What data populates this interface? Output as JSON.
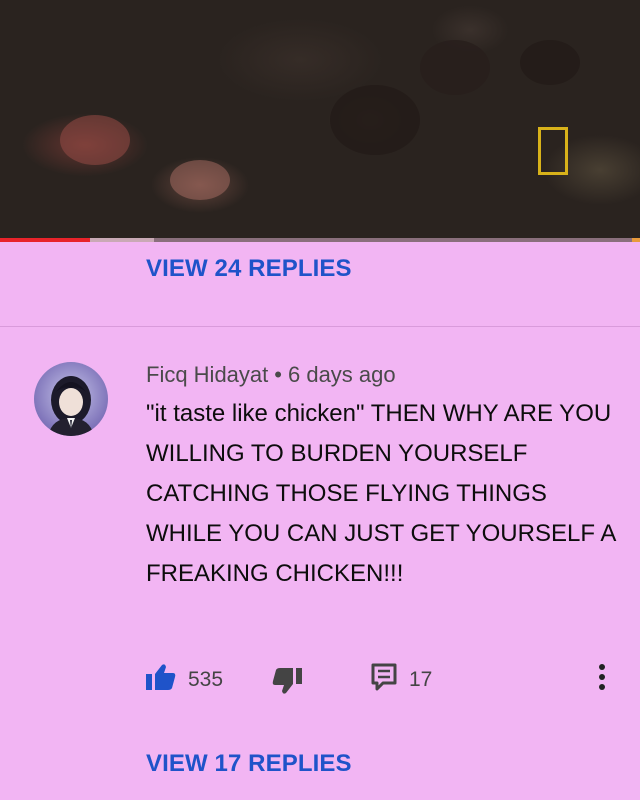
{
  "video": {
    "progress_fraction": 0.14,
    "buffered_fraction": 0.24,
    "logo_color": "#d8b21a"
  },
  "thread_top": {
    "view_replies_label": "VIEW 24 REPLIES"
  },
  "comment": {
    "author": "Ficq Hidayat",
    "separator": "•",
    "timestamp": "6 days ago",
    "text": "\"it taste like chicken\" THEN WHY ARE YOU WILLING TO BURDEN YOURSELF CATCHING THOSE FLYING THINGS WHILE YOU CAN JUST GET YOURSELF A FREAKING CHICKEN!!!",
    "like_count": "535",
    "reply_count": "17",
    "like_icon": "thumbs-up-icon",
    "dislike_icon": "thumbs-down-icon",
    "reply_icon": "reply-icon",
    "more_icon": "more-vertical-icon",
    "view_replies_label": "VIEW 17 REPLIES"
  },
  "colors": {
    "background": "#f2b5f3",
    "link_blue": "#1f53c9",
    "progress_red": "#e8232a"
  }
}
